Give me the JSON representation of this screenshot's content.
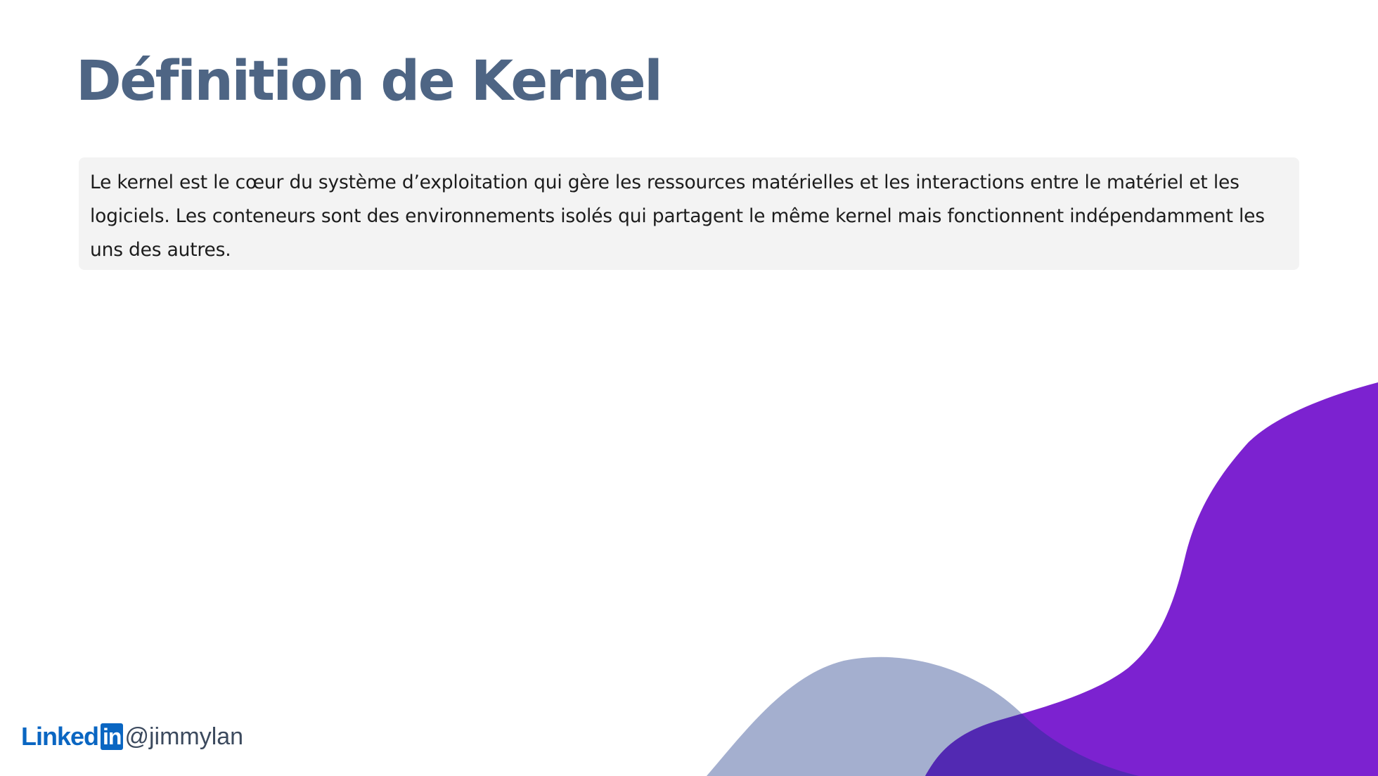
{
  "slide": {
    "title": "Définition de Kernel",
    "definition": "Le kernel est le cœur du système d’exploitation qui gère les ressources matérielles et les interactions entre le matériel et les logiciels. Les conteneurs sont des environnements isolés qui partagent le même kernel mais fonctionnent indépendamment les uns des autres."
  },
  "footer": {
    "brand_word": "Linked",
    "brand_badge": "in",
    "handle": "@jimmylan"
  },
  "colors": {
    "title": "#4e6584",
    "box_background": "#f3f3f3",
    "wave_purple": "#7c22d0",
    "wave_slate": "#a4afcf",
    "wave_overlap": "#5229b2",
    "linkedin_blue": "#0a66c2"
  },
  "icons": {
    "brand_logo": "linkedin-logo"
  }
}
